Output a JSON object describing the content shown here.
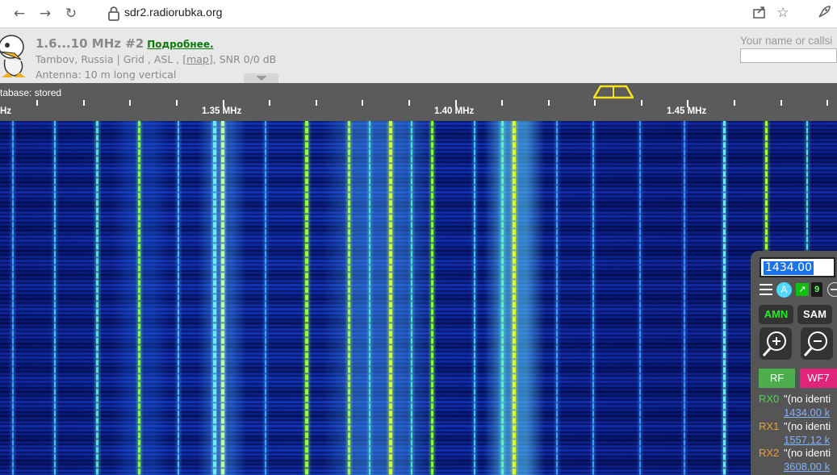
{
  "browser": {
    "url": "sdr2.radiorubka.org"
  },
  "header": {
    "title": "1.6...10 MHz #2",
    "more_link": "Подробнее.",
    "location_prefix": "Tambov, Russia | Grid , ASL , ",
    "map_link": "[map]",
    "location_suffix": ", SNR 0/0 dB",
    "antenna": "Antenna: 10 m long vertical",
    "name_label": "Your name or callsi",
    "name_value": ""
  },
  "scale": {
    "db_status": "tabase: stored",
    "labels": [
      {
        "text": "Hz"
      },
      {
        "text": "1.35 MHz"
      },
      {
        "text": "1.40 MHz"
      },
      {
        "text": "1.45 MHz"
      }
    ]
  },
  "panel": {
    "frequency": "1434.00",
    "agc_label": "A",
    "nine_label": "9",
    "mode_amn": "AMN",
    "mode_sam": "SAM",
    "rf_label": "RF",
    "wf_label": "WF7",
    "rx": [
      {
        "label": "RX0",
        "name": "\"(no identi",
        "freq": "1434.00 k",
        "color": "#44dd44"
      },
      {
        "label": "RX1",
        "name": "\"(no identi",
        "freq": "1557.12 k",
        "color": "#f0a030"
      },
      {
        "label": "RX2",
        "name": "\"(no identi",
        "freq": "3608.00 k",
        "color": "#f0a030"
      }
    ]
  },
  "colors": {
    "waterfall_base": "#0c28a6",
    "signal_line": "#7dff3a",
    "passband": "#f4e21a",
    "scale_bg": "#5b5b5b"
  }
}
